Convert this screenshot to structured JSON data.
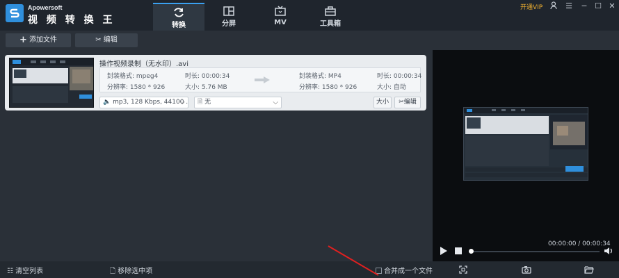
{
  "app": {
    "brand_small": "Apowersoft",
    "brand_big": "视 频 转 换 王",
    "vip": "开通VIP"
  },
  "tabs": [
    {
      "label": "转换",
      "icon": "refresh-icon",
      "active": true
    },
    {
      "label": "分屏",
      "icon": "split-screen-icon",
      "active": false
    },
    {
      "label": "MV",
      "icon": "tv-icon",
      "active": false
    },
    {
      "label": "工具箱",
      "icon": "toolbox-icon",
      "active": false
    }
  ],
  "window": {
    "icons": [
      "user-icon",
      "menu-icon",
      "minimize-icon",
      "maximize-icon",
      "close-icon"
    ]
  },
  "toolbar": {
    "add_file": "添加文件",
    "edit": "编辑"
  },
  "file": {
    "name": "操作视频录制（无水印）.avi",
    "src_format": "封装格式: mpeg4",
    "src_duration": "时长: 00:00:34",
    "src_resolution": "分辨率: 1580 * 926",
    "src_size": "大小: 5.76 MB",
    "dst_format": "封装格式: MP4",
    "dst_duration": "时长: 00:00:34",
    "dst_resolution": "分辨率: 1580 * 926",
    "dst_size": "大小: 自动",
    "audio": "mp3, 128 Kbps, 44100 ...",
    "subtitle": "无",
    "size_btn": "大小",
    "edit_btn": "编辑"
  },
  "bottom": {
    "clear": "清空列表",
    "remove": "移除选中项",
    "merge": "合并成一个文件"
  },
  "player": {
    "time": "00:00:00 / 00:00:34",
    "progress": 0.0
  },
  "colors": {
    "accent": "#3aa0f0",
    "vip": "#f0b030"
  }
}
